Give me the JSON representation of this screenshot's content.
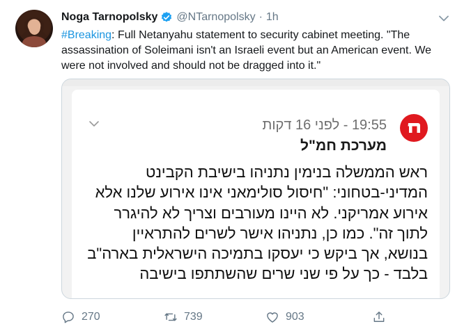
{
  "tweet": {
    "author_name": "Noga Tarnopolsky",
    "handle": "@NTarnopolsky",
    "separator": "·",
    "time": "1h",
    "hashtag": "#Breaking",
    "text": ": Full Netanyahu statement to security cabinet meeting. \"The assassination of Soleimani isn't an Israeli event but an American event. We were not involved and should not be dragged into it.\""
  },
  "card": {
    "meta": "19:55 - לפני 16 דקות",
    "org": "מערכת חמ\"ל",
    "body": "ראש הממשלה בנימין נתניהו בישיבת הקבינט המדיני-בטחוני: \"חיסול סולימאני אינו אירוע שלנו אלא אירוע אמריקני. לא היינו מעורבים וצריך לא להיגרר לתוך זה\". כמו כן, נתניהו אישר לשרים להתראיין בנושא, אך ביקש כי יעסקו בתמיכה הישראלית בארה\"ב בלבד - כך על פי שני שרים שהשתתפו בישיבה"
  },
  "actions": {
    "replies": "270",
    "retweets": "739",
    "likes": "903"
  },
  "colors": {
    "accent": "#1b95e0",
    "muted": "#657786",
    "logo_red": "#e0191f"
  },
  "icons": [
    "verified-badge-icon",
    "chevron-down-icon",
    "reply-icon",
    "retweet-icon",
    "like-icon",
    "share-icon",
    "hamal-logo-icon"
  ]
}
